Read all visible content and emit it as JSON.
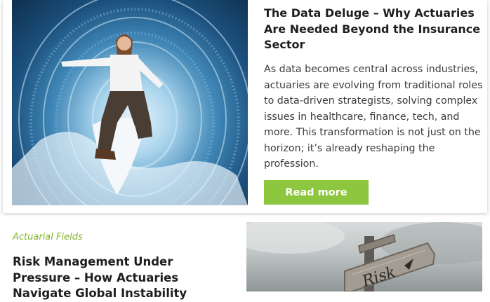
{
  "article1": {
    "title": "The Data Deluge – Why Actuaries Are Needed Beyond the Insurance Sector",
    "description": "As data becomes central across industries, actuaries are evolving from traditional roles to data-driven strategists, solving complex issues in healthcare, finance, tech, and more. This transformation is not just on the horizon; it’s already reshaping the profession.",
    "button_label": "Read more",
    "image_icon": "surfer-data-wave-image"
  },
  "article2": {
    "category": "Actuarial Fields",
    "title": "Risk Management Under Pressure – How Actuaries Navigate Global Instability",
    "image_icon": "risk-signpost-image"
  },
  "colors": {
    "accent_green": "#8dc63f",
    "category_green": "#7fb528"
  }
}
